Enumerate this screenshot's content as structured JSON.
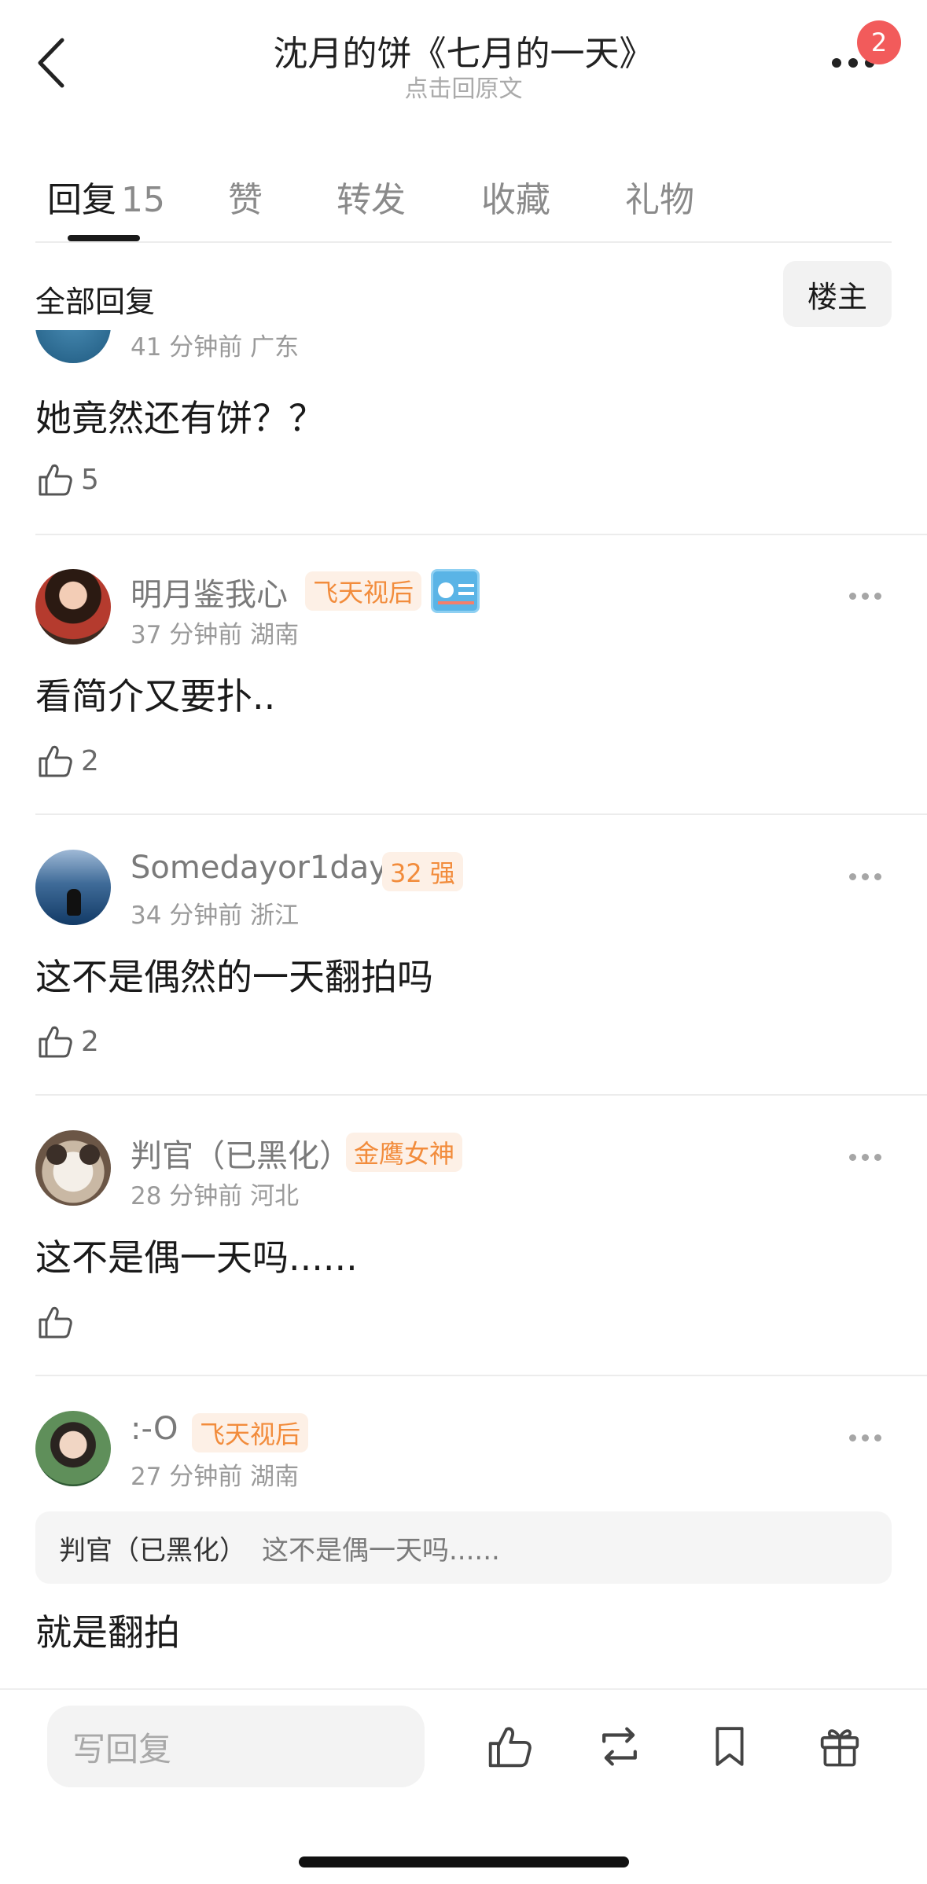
{
  "header": {
    "title": "沈月的饼《七月的一天》",
    "subtitle": "点击回原文",
    "notification_count": "2"
  },
  "tabs": [
    {
      "label": "回复",
      "count": "15"
    },
    {
      "label": "赞"
    },
    {
      "label": "转发"
    },
    {
      "label": "收藏"
    },
    {
      "label": "礼物"
    }
  ],
  "section": {
    "title": "全部回复",
    "filter_label": "楼主"
  },
  "comments": [
    {
      "meta": "41 分钟前 广东",
      "text": "她竟然还有饼？？",
      "likes": "5"
    },
    {
      "username": "明月鉴我心",
      "tag": "飞天视后",
      "meta": "37 分钟前 湖南",
      "text": "看简介又要扑..",
      "likes": "2"
    },
    {
      "username": "Somedayor1day",
      "tag": "32 强",
      "meta": "34 分钟前 浙江",
      "text": "这不是偶然的一天翻拍吗",
      "likes": "2"
    },
    {
      "username": "判官（已黑化）",
      "tag": "金鹰女神",
      "meta": "28 分钟前 河北",
      "text": "这不是偶一天吗......",
      "likes": ""
    },
    {
      "username": ":-O",
      "tag": "飞天视后",
      "meta": "27 分钟前 湖南",
      "quote_user": "判官（已黑化）",
      "quote_text": "这不是偶一天吗......",
      "text": "就是翻拍"
    }
  ],
  "bottom_bar": {
    "reply_placeholder": "写回复"
  }
}
